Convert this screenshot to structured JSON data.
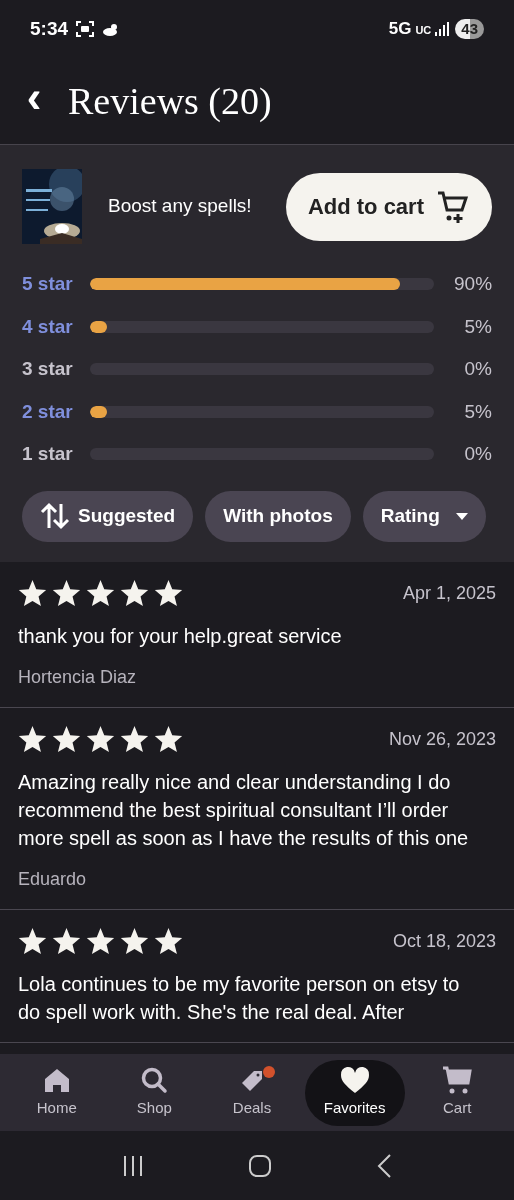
{
  "status_bar": {
    "time": "5:34",
    "network": "5G",
    "network_suffix": "UC",
    "battery": "43"
  },
  "header": {
    "back": "‹",
    "title": "Reviews (20)"
  },
  "product": {
    "name": "Boost any spells!",
    "button": "Add to cart"
  },
  "rating_breakdown": [
    {
      "label": "5 star",
      "active": true,
      "level": 0.9,
      "percent": "90%"
    },
    {
      "label": "4 star",
      "active": true,
      "level": 0.05,
      "percent": "5%"
    },
    {
      "label": "3 star",
      "active": false,
      "percent": "0%"
    },
    {
      "label": "2 star",
      "active": true,
      "level": 0.05,
      "percent": "5%"
    },
    {
      "label": "1 star",
      "active": false,
      "percent": "0%"
    }
  ],
  "filters": [
    {
      "kind": "sort",
      "label": "Suggested"
    },
    {
      "kind": "plain",
      "label": "With photos"
    },
    {
      "kind": "dropdown",
      "label": "Rating"
    }
  ],
  "reviews": [
    {
      "stars": 5,
      "date": "Apr 1, 2025",
      "text": "thank you for your help.great service",
      "author": "Hortencia Diaz"
    },
    {
      "stars": 5,
      "date": "Nov 26, 2023",
      "text": "Amazing really nice and clear understanding I do recommend the best spiritual consultant I’ll order more spell as soon as I have the results of this one",
      "author": "Eduardo"
    },
    {
      "stars": 5,
      "date": "Oct 18, 2023",
      "text": "Lola continues to be my favorite person on etsy to do spell work with. She's the real deal. After"
    }
  ],
  "bottom_nav": [
    {
      "kind": "home",
      "label": "Home",
      "selected": false,
      "notification": false
    },
    {
      "kind": "shop",
      "label": "Shop",
      "selected": false,
      "notification": false
    },
    {
      "kind": "deals",
      "label": "Deals",
      "selected": false,
      "notification": true
    },
    {
      "kind": "favorites",
      "label": "Favorites",
      "selected": true,
      "notification": false
    },
    {
      "kind": "cart",
      "label": "Cart",
      "selected": false,
      "notification": false
    }
  ]
}
